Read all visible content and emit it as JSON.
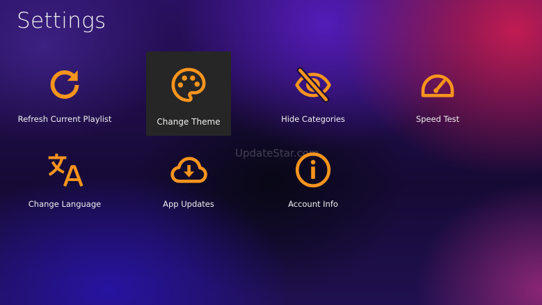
{
  "page": {
    "title": "Settings",
    "watermark": "UpdateStar.com"
  },
  "colors": {
    "accent": "#f7941d",
    "selected_tile": "#262626"
  },
  "tiles": [
    {
      "label": "Refresh Current Playlist",
      "icon": "refresh-icon"
    },
    {
      "label": "Change Theme",
      "icon": "palette-icon",
      "selected": true
    },
    {
      "label": "Hide Categories",
      "icon": "eye-off-icon"
    },
    {
      "label": "Speed Test",
      "icon": "speedometer-icon"
    },
    {
      "label": "Change Language",
      "icon": "translate-icon"
    },
    {
      "label": "App Updates",
      "icon": "cloud-download-icon"
    },
    {
      "label": "Account Info",
      "icon": "info-icon"
    }
  ]
}
